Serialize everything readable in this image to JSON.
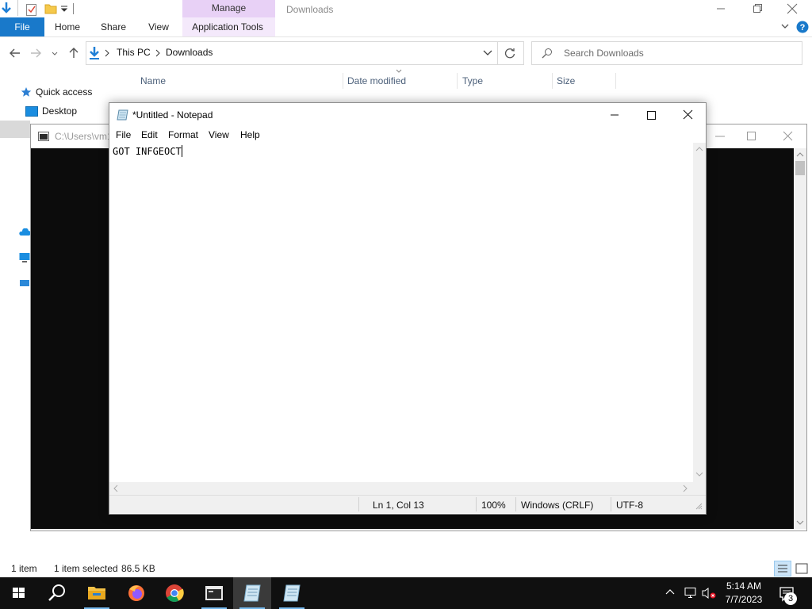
{
  "explorer": {
    "window_title": "Downloads",
    "context_tab": "Manage",
    "tabs": [
      "File",
      "Home",
      "Share",
      "View",
      "Application Tools"
    ],
    "breadcrumb": [
      "This PC",
      "Downloads"
    ],
    "search_placeholder": "Search Downloads",
    "columns": [
      "Name",
      "Date modified",
      "Type",
      "Size"
    ],
    "nav_items": [
      "Quick access",
      "Desktop"
    ],
    "status_items": "1 item",
    "status_selected": "1 item selected",
    "status_size": "86.5 KB"
  },
  "console": {
    "title": "C:\\Users\\vm1"
  },
  "notepad": {
    "title": "*Untitled - Notepad",
    "menu": [
      "File",
      "Edit",
      "Format",
      "View",
      "Help"
    ],
    "content": "GOT INFGEOCT",
    "status": {
      "position": "Ln 1, Col 13",
      "zoom": "100%",
      "line_ending": "Windows (CRLF)",
      "encoding": "UTF-8"
    }
  },
  "taskbar": {
    "time": "5:14 AM",
    "date": "7/7/2023",
    "notification_count": "3",
    "accent": "#76b9ed"
  }
}
